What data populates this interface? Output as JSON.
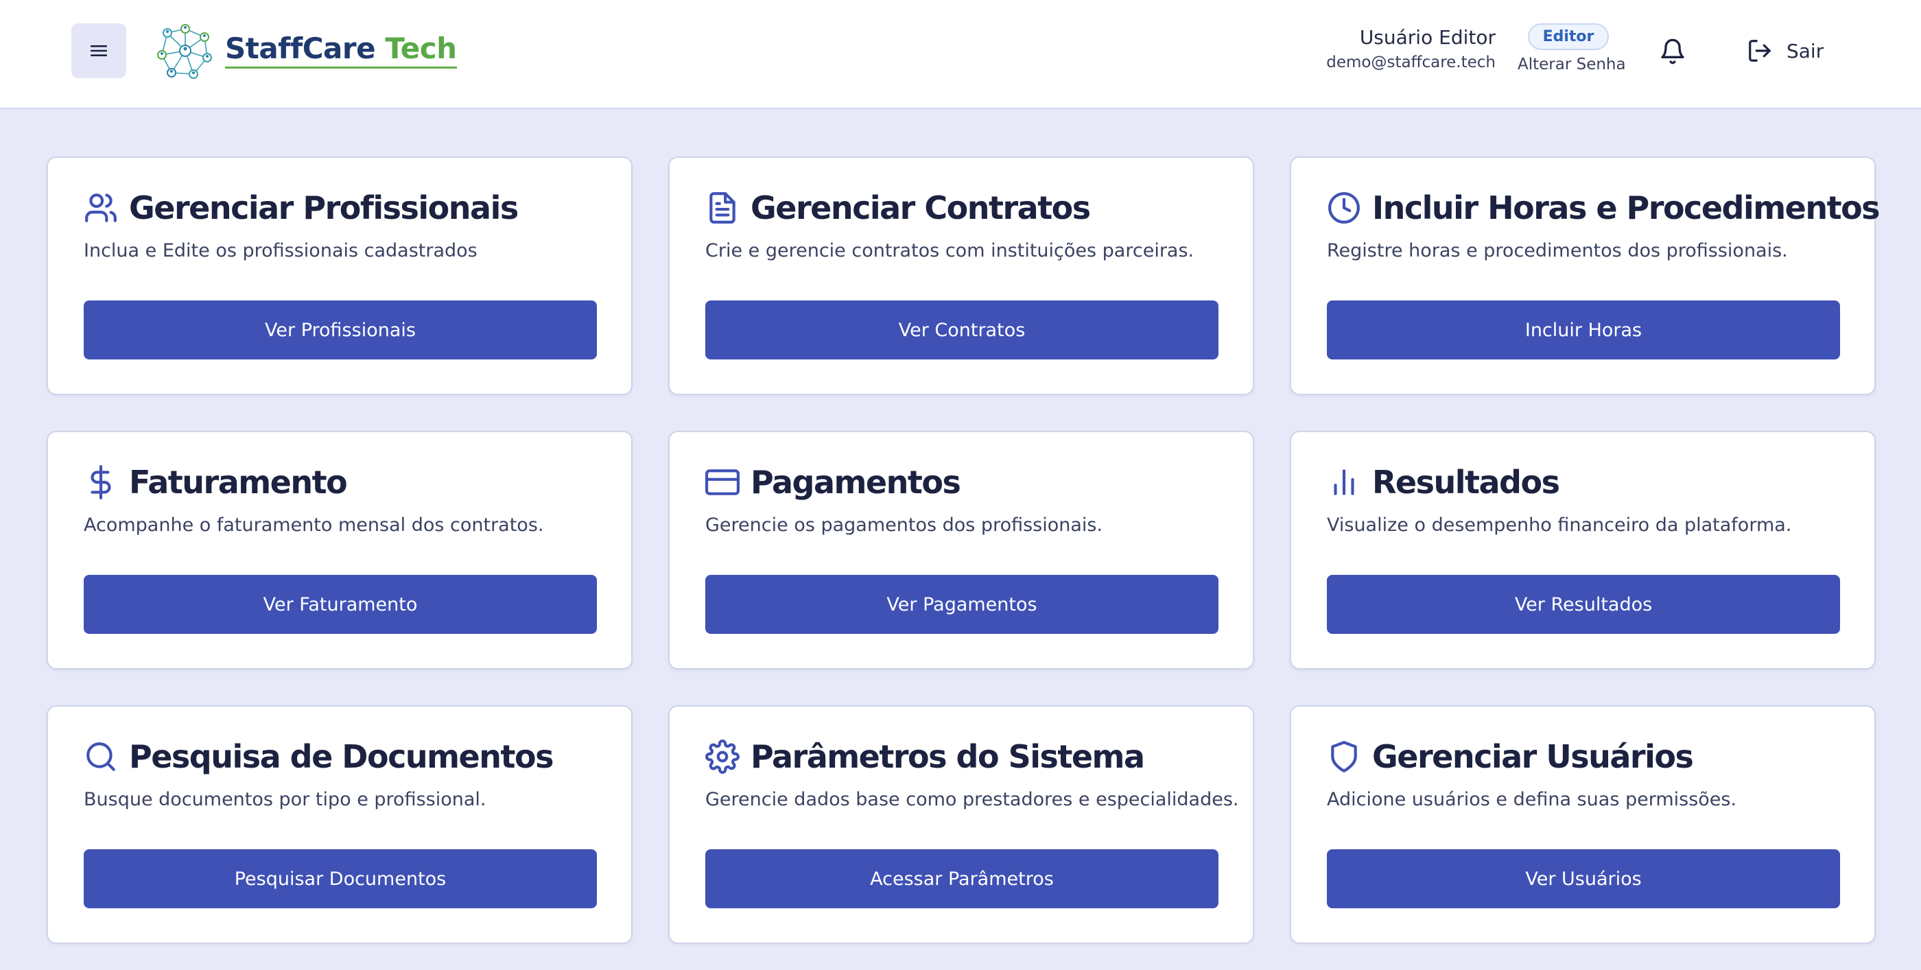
{
  "header": {
    "brand_part1": "StaffCare",
    "brand_part2": " Tech",
    "user_name": "Usuário Editor",
    "user_email": "demo@staffcare.tech",
    "role_badge": "Editor",
    "change_password": "Alterar Senha",
    "logout_label": "Sair"
  },
  "colors": {
    "primary": "#3f51b5",
    "background": "#e8e9f8",
    "brand_blue": "#1f3a6e",
    "brand_green": "#5aa947"
  },
  "cards": [
    {
      "icon": "users-icon",
      "title": "Gerenciar Profissionais",
      "description": "Inclua e Edite os profissionais cadastrados",
      "button": "Ver Profissionais"
    },
    {
      "icon": "document-icon",
      "title": "Gerenciar Contratos",
      "description": "Crie e gerencie contratos com instituições parceiras.",
      "button": "Ver Contratos"
    },
    {
      "icon": "clock-icon",
      "title": "Incluir Horas e Procedimentos",
      "description": "Registre horas e procedimentos dos profissionais.",
      "button": "Incluir Horas"
    },
    {
      "icon": "dollar-icon",
      "title": "Faturamento",
      "description": "Acompanhe o faturamento mensal dos contratos.",
      "button": "Ver Faturamento"
    },
    {
      "icon": "credit-card-icon",
      "title": "Pagamentos",
      "description": "Gerencie os pagamentos dos profissionais.",
      "button": "Ver Pagamentos"
    },
    {
      "icon": "bar-chart-icon",
      "title": "Resultados",
      "description": "Visualize o desempenho financeiro da plataforma.",
      "button": "Ver Resultados"
    },
    {
      "icon": "search-icon",
      "title": "Pesquisa de Documentos",
      "description": "Busque documentos por tipo e profissional.",
      "button": "Pesquisar Documentos"
    },
    {
      "icon": "gear-icon",
      "title": "Parâmetros do Sistema",
      "description": "Gerencie dados base como prestadores e especialidades.",
      "button": "Acessar Parâmetros"
    },
    {
      "icon": "shield-icon",
      "title": "Gerenciar Usuários",
      "description": "Adicione usuários e defina suas permissões.",
      "button": "Ver Usuários"
    }
  ]
}
